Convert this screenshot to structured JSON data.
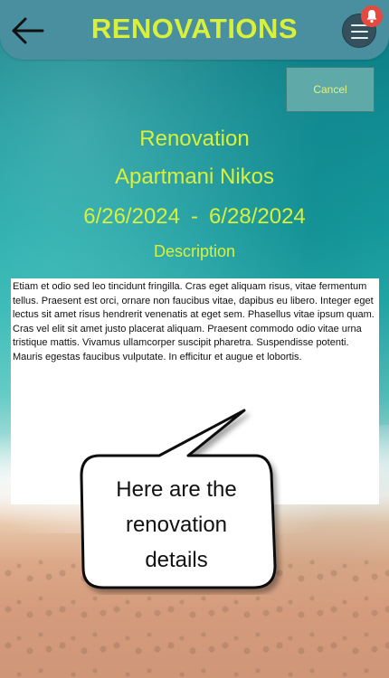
{
  "header": {
    "title": "RENOVATIONS",
    "back_icon": "arrow-left-icon",
    "menu_icon": "hamburger-menu-icon",
    "notification_icon": "bell-icon"
  },
  "actions": {
    "cancel_label": "Cancel"
  },
  "details": {
    "type": "Renovation",
    "apartment": "Apartmani Nikos",
    "start_date": "6/26/2024",
    "separator": "-",
    "end_date": "6/28/2024",
    "description_label": "Description",
    "description_text": "Etiam et odio sed leo tincidunt fringilla. Cras eget aliquam risus, vitae fermentum tellus. Praesent est orci, ornare non faucibus vitae, dapibus eu libero. Integer eget lectus sit amet risus hendrerit venenatis at eget sem. Phasellus vitae ipsum quam. Cras vel elit sit amet justo placerat aliquam. Praesent commodo odio vitae urna tristique mattis. Vivamus ullamcorper suscipit pharetra. Suspendisse potenti. Mauris egestas faucibus vulputate. In efficitur et augue et lobortis."
  },
  "tooltip": {
    "text": "Here are the renovation details"
  },
  "colors": {
    "accent": "#d9f03a",
    "header_bg": "#4a8fa0",
    "notification": "#e44a3f"
  }
}
